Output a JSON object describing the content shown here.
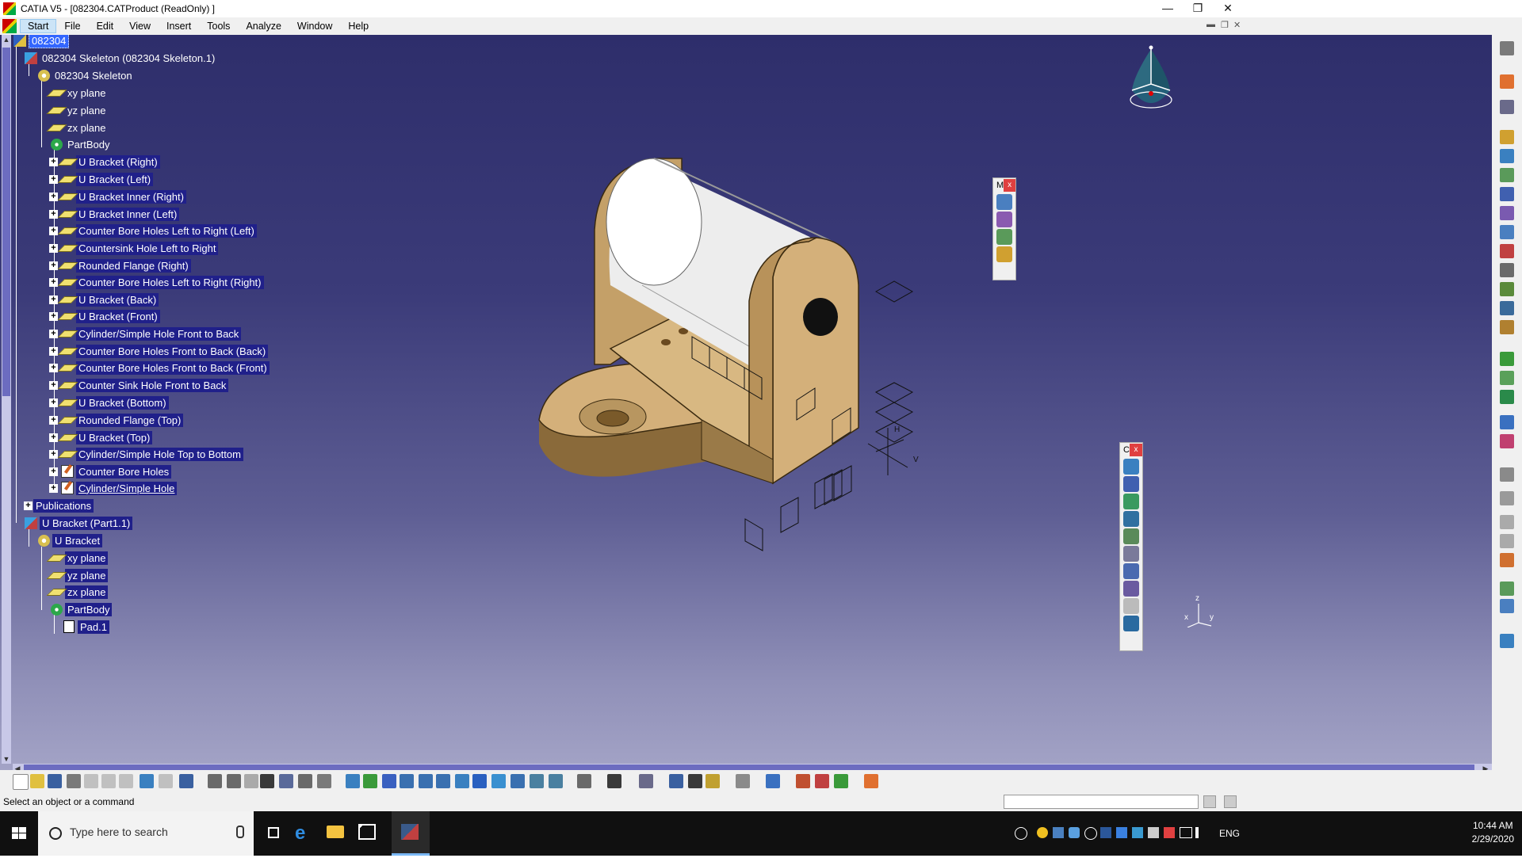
{
  "window": {
    "title": "CATIA V5 - [082304.CATProduct (ReadOnly) ]",
    "minimize": "—",
    "restore": "❐",
    "close": "✕"
  },
  "menu": {
    "items": [
      "Start",
      "File",
      "Edit",
      "View",
      "Insert",
      "Tools",
      "Analyze",
      "Window",
      "Help"
    ],
    "active": "Start"
  },
  "tree": {
    "root": "082304",
    "skeleton_instance": "082304 Skeleton (082304 Skeleton.1)",
    "skeleton_part": "082304 Skeleton",
    "skeleton_planes": [
      "xy plane",
      "yz plane",
      "zx plane"
    ],
    "partbody": "PartBody",
    "features": [
      "U Bracket (Right)",
      "U Bracket (Left)",
      "U Bracket Inner (Right)",
      "U Bracket Inner (Left)",
      "Counter Bore Holes Left to Right (Left)",
      "Countersink Hole Left to Right",
      "Rounded Flange (Right)",
      "Counter Bore Holes Left to Right (Right)",
      "U Bracket (Back)",
      "U Bracket (Front)",
      "Cylinder/Simple Hole Front to Back",
      "Counter Bore Holes Front to Back (Back)",
      "Counter Bore Holes Front to Back (Front)",
      "Counter Sink Hole Front to Back",
      "U Bracket (Bottom)",
      "Rounded Flange (Top)",
      "U Bracket (Top)",
      "Cylinder/Simple Hole Top to Bottom",
      "Counter Bore Holes",
      "Cylinder/Simple Hole"
    ],
    "publications": "Publications",
    "part_instance": "U Bracket (Part1.1)",
    "part": "U Bracket",
    "part_planes": [
      "xy plane",
      "yz plane",
      "zx plane"
    ],
    "part_body": "PartBody",
    "pad": "Pad.1"
  },
  "floating_toolbars": {
    "t1_title": "M",
    "t2_title": "C",
    "close": "x"
  },
  "axis_labels": {
    "x": "x",
    "y": "y",
    "z": "z"
  },
  "status": {
    "message": "Select an object or a command"
  },
  "taskbar": {
    "search_placeholder": "Type here to search",
    "language": "ENG",
    "time": "10:44 AM",
    "date": "2/29/2020"
  },
  "colors": {
    "viewport_top": "#2e2e6b",
    "viewport_bottom": "#a3a3c6",
    "bracket": "#d4b07a",
    "tree_highlight": "#20208a",
    "selection": "#3366ff"
  }
}
